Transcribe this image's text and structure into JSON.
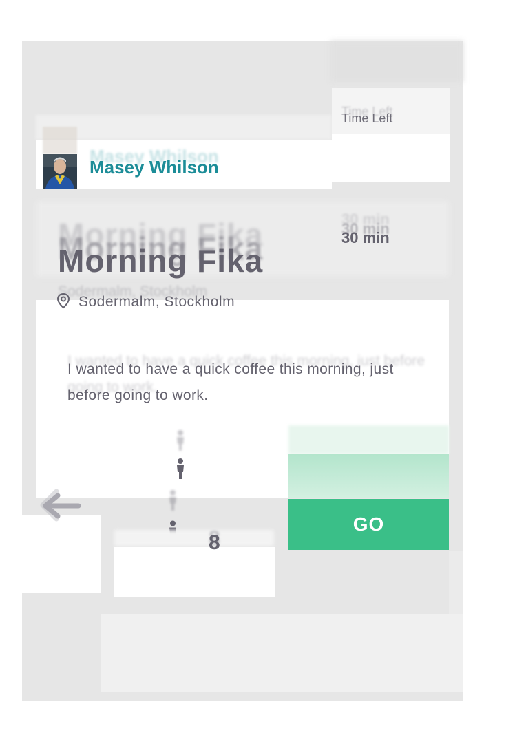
{
  "user": {
    "name": "Masey Whilson"
  },
  "time": {
    "label": "Time Left",
    "value": "30 min"
  },
  "event": {
    "title": "Morning Fika",
    "location": "Sodermalm, Stockholm",
    "description": "I wanted to have a quick coffee this morning, just before going to work."
  },
  "participants": {
    "count": "8"
  },
  "actions": {
    "go_label": "GO"
  },
  "icons": {
    "avatar": "user-avatar-photo",
    "location": "map-pin-icon",
    "person": "person-icon",
    "back": "arrow-left-icon"
  },
  "colors": {
    "accent_teal": "#1c8d98",
    "go_green": "#3abf88",
    "text": "#64626e"
  }
}
